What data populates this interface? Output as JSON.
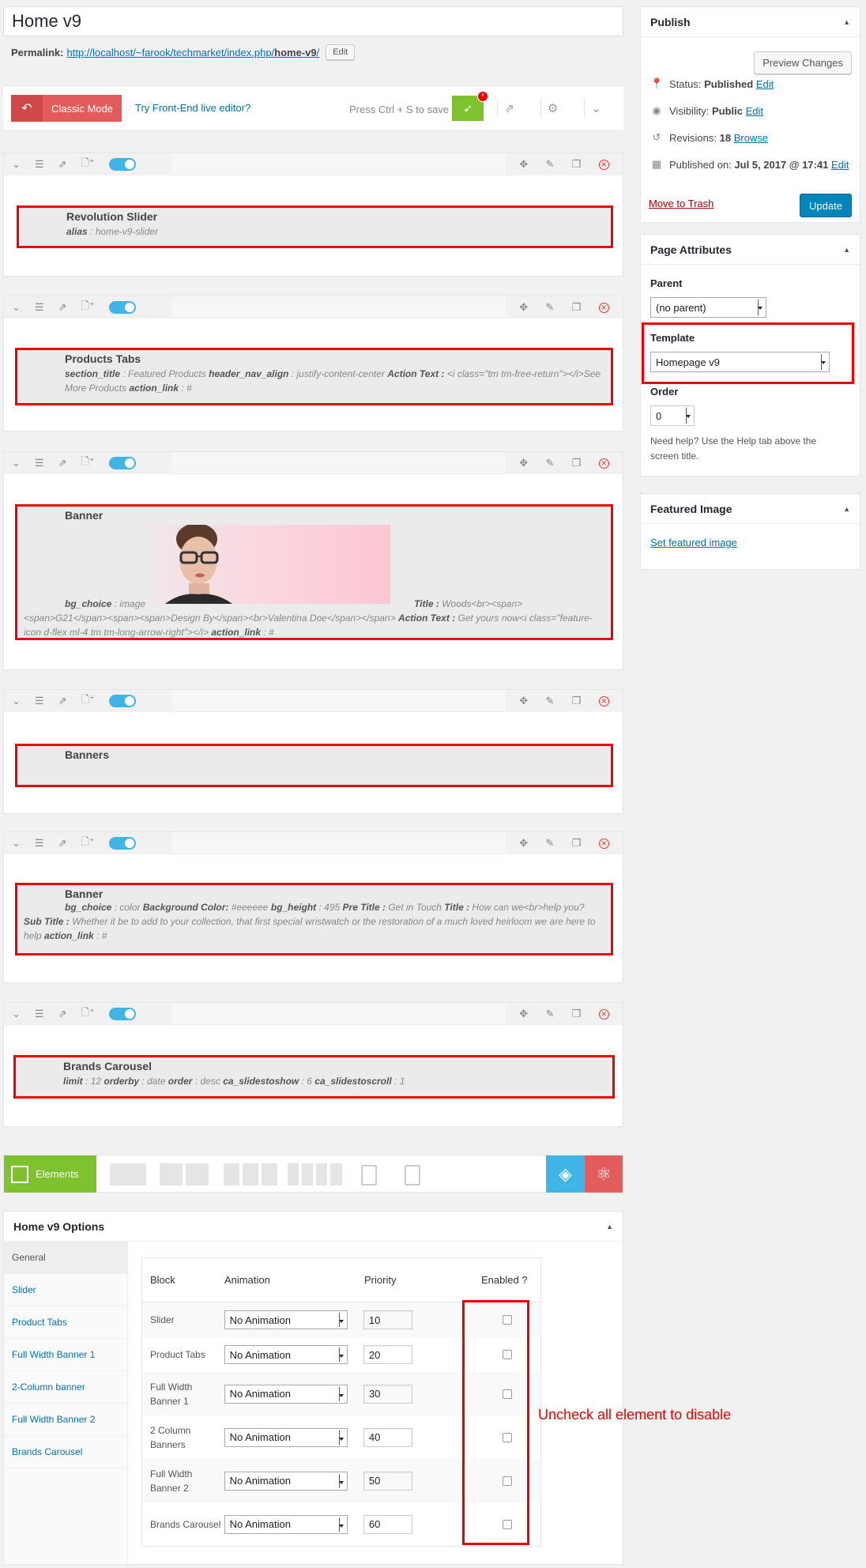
{
  "page": {
    "title_value": "Home v9",
    "permalink_label": "Permalink:",
    "permalink_url_base": "http://localhost/~farook/techmarket/index.php/",
    "permalink_slug": "home-v9",
    "permalink_slash": "/",
    "permalink_edit": "Edit"
  },
  "vc_bar": {
    "classic_mode": "Classic Mode",
    "frontend_link": "Try Front-End live editor?",
    "save_hint": "Press Ctrl + S to save",
    "badge": "*"
  },
  "rows": [
    {
      "element": "Revolution Slider",
      "params": [
        {
          "k": "alias",
          "v": "home-v9-slider"
        }
      ]
    },
    {
      "element": "Products Tabs",
      "params": [
        {
          "k": "section_title",
          "v": "Featured Products"
        },
        {
          "k": "header_nav_align",
          "v": "justify-content-center"
        },
        {
          "k": "Action Text :",
          "v": "<i class=\"tm tm-free-return\"></i>See More Products"
        },
        {
          "k": "action_link",
          "v": "#"
        }
      ]
    },
    {
      "element": "Banner",
      "params_text": {
        "k1": "bg_choice",
        "v1": "image",
        "k2": "Title :",
        "v2": "Woods<br><span><span>G21</span><span><span>Design By</span><br>Valentina Doe</span></span>",
        "k3": "Action Text :",
        "v3": "Get yours now<i class=\"feature-icon d-flex ml-4 tm tm-long-arrow-right\"></i>",
        "k4": "action_link",
        "v4": "#"
      }
    },
    {
      "element": "Banners"
    },
    {
      "element": "Banner",
      "params_text": {
        "k1": "bg_choice",
        "v1": "color",
        "k2": "Background Color:",
        "v2": "#eeeeee",
        "k3": "bg_height",
        "v3": "495",
        "k4": "Pre Title :",
        "v4": "Get in Touch",
        "k5": "Title :",
        "v5": "How can we<br>help you?",
        "k6": "Sub Title :",
        "v6": "Whether it be to add to your collection, that first special wristwatch or the restoration of a much loved heirloom we are here to help",
        "k7": "action_link",
        "v7": "#"
      }
    },
    {
      "element": "Brands Carousel",
      "params": [
        {
          "k": "limit",
          "v": "12"
        },
        {
          "k": "orderby",
          "v": "date"
        },
        {
          "k": "order",
          "v": "desc"
        },
        {
          "k": "ca_slidestoshow",
          "v": "6"
        },
        {
          "k": "ca_slidestoscroll",
          "v": "1"
        }
      ]
    }
  ],
  "elements_bar": {
    "label": "Elements"
  },
  "options": {
    "title": "Home v9 Options",
    "nav": [
      "General",
      "Slider",
      "Product Tabs",
      "Full Width Banner 1",
      "2-Column banner",
      "Full Width Banner 2",
      "Brands Carousel"
    ],
    "headers": {
      "block": "Block",
      "animation": "Animation",
      "priority": "Priority",
      "enabled": "Enabled ?"
    },
    "rows": [
      {
        "block": "Slider",
        "animation": "No Animation",
        "priority": "10"
      },
      {
        "block": "Product Tabs",
        "animation": "No Animation",
        "priority": "20"
      },
      {
        "block": "Full Width Banner 1",
        "animation": "No Animation",
        "priority": "30"
      },
      {
        "block": "2 Column Banners",
        "animation": "No Animation",
        "priority": "40"
      },
      {
        "block": "Full Width Banner 2",
        "animation": "No Animation",
        "priority": "50"
      },
      {
        "block": "Brands Carousel",
        "animation": "No Animation",
        "priority": "60"
      }
    ],
    "annotation": "Uncheck all element to disable"
  },
  "publish": {
    "title": "Publish",
    "preview": "Preview Changes",
    "status_label": "Status:",
    "status_value": "Published",
    "edit": "Edit",
    "visibility_label": "Visibility:",
    "visibility_value": "Public",
    "revisions_label": "Revisions:",
    "revisions_value": "18",
    "browse": "Browse",
    "published_label": "Published on:",
    "published_value": "Jul 5, 2017 @ 17:41",
    "trash": "Move to Trash",
    "update": "Update"
  },
  "page_attributes": {
    "title": "Page Attributes",
    "parent_label": "Parent",
    "parent_value": "(no parent)",
    "template_label": "Template",
    "template_value": "Homepage v9",
    "order_label": "Order",
    "order_value": "0",
    "help": "Need help? Use the Help tab above the screen title."
  },
  "featured_image": {
    "title": "Featured Image",
    "link": "Set featured image"
  },
  "colors": {
    "accent": "#0073aa",
    "highlight": "#ee0000",
    "classic": "#e25c5c",
    "save": "#7fc22f",
    "toggle": "#3fb4e5"
  }
}
